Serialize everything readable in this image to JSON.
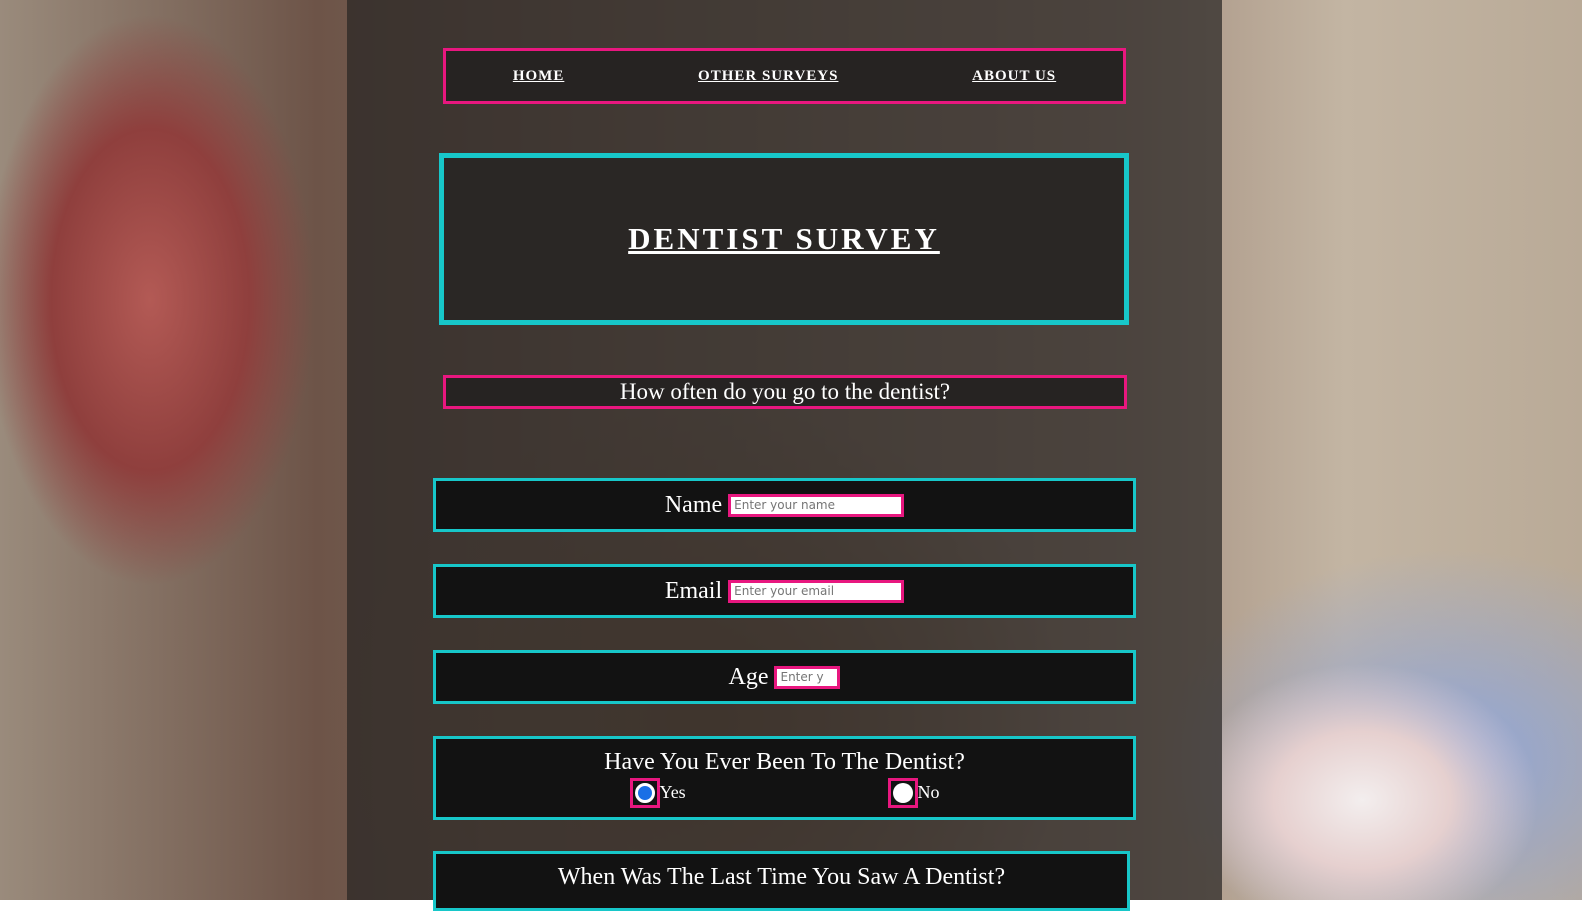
{
  "nav": {
    "items": [
      {
        "label": "HOME"
      },
      {
        "label": "OTHER SURVEYS"
      },
      {
        "label": "ABOUT US"
      }
    ]
  },
  "header": {
    "title": "DENTIST SURVEY"
  },
  "intro": {
    "question": "How often do you go to the dentist?"
  },
  "form": {
    "name": {
      "label": "Name",
      "placeholder": "Enter your name"
    },
    "email": {
      "label": "Email",
      "placeholder": "Enter your email"
    },
    "age": {
      "label": "Age",
      "placeholder": "Enter y"
    },
    "been_to_dentist": {
      "question": "Have You Ever Been To The Dentist?",
      "options": [
        {
          "label": "Yes",
          "checked": true
        },
        {
          "label": "No",
          "checked": false
        }
      ]
    },
    "last_visit": {
      "question": "When Was The Last Time You Saw A Dentist?"
    }
  },
  "colors": {
    "pink_border": "#e8177f",
    "cyan_border": "#17c7c9",
    "radio_selected": "#1a6fe6"
  }
}
